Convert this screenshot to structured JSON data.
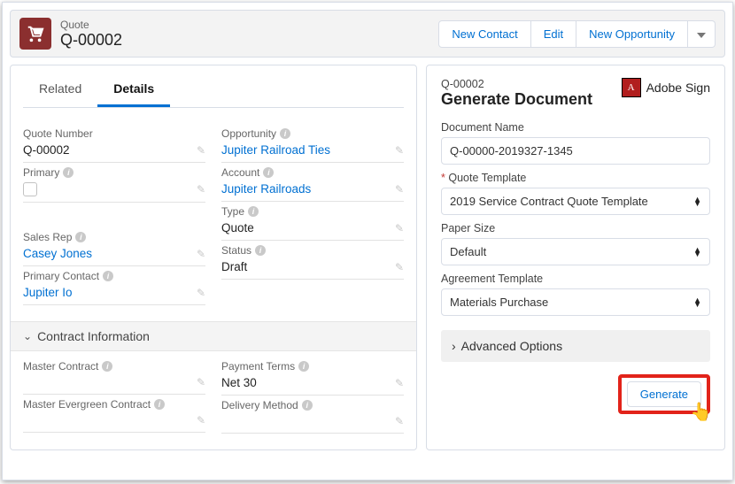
{
  "header": {
    "object_label": "Quote",
    "record_name": "Q-00002",
    "actions": {
      "new_contact": "New Contact",
      "edit": "Edit",
      "new_opportunity": "New Opportunity"
    }
  },
  "tabs": {
    "related": "Related",
    "details": "Details"
  },
  "details": {
    "left": {
      "quote_number": {
        "label": "Quote Number",
        "value": "Q-00002"
      },
      "primary": {
        "label": "Primary",
        "checked": false
      },
      "sales_rep": {
        "label": "Sales Rep",
        "value": "Casey Jones"
      },
      "primary_contact": {
        "label": "Primary Contact",
        "value": "Jupiter Io"
      }
    },
    "right": {
      "opportunity": {
        "label": "Opportunity",
        "value": "Jupiter Railroad Ties"
      },
      "account": {
        "label": "Account",
        "value": "Jupiter Railroads"
      },
      "type": {
        "label": "Type",
        "value": "Quote"
      },
      "status": {
        "label": "Status",
        "value": "Draft"
      }
    },
    "section_contract": {
      "title": "Contract Information",
      "left": {
        "master_contract": {
          "label": "Master Contract",
          "value": ""
        },
        "master_evergreen": {
          "label": "Master Evergreen Contract",
          "value": ""
        }
      },
      "right": {
        "payment_terms": {
          "label": "Payment Terms",
          "value": "Net 30"
        },
        "delivery_method": {
          "label": "Delivery Method",
          "value": ""
        }
      }
    }
  },
  "generate": {
    "record_ref": "Q-00002",
    "title": "Generate Document",
    "provider": "Adobe Sign",
    "doc_name_label": "Document Name",
    "doc_name_value": "Q-00000-2019327-1345",
    "quote_template_label": "Quote Template",
    "quote_template_value": "2019 Service Contract Quote Template",
    "paper_size_label": "Paper Size",
    "paper_size_value": "Default",
    "agreement_template_label": "Agreement Template",
    "agreement_template_value": "Materials Purchase",
    "advanced_label": "Advanced Options",
    "generate_button": "Generate"
  }
}
